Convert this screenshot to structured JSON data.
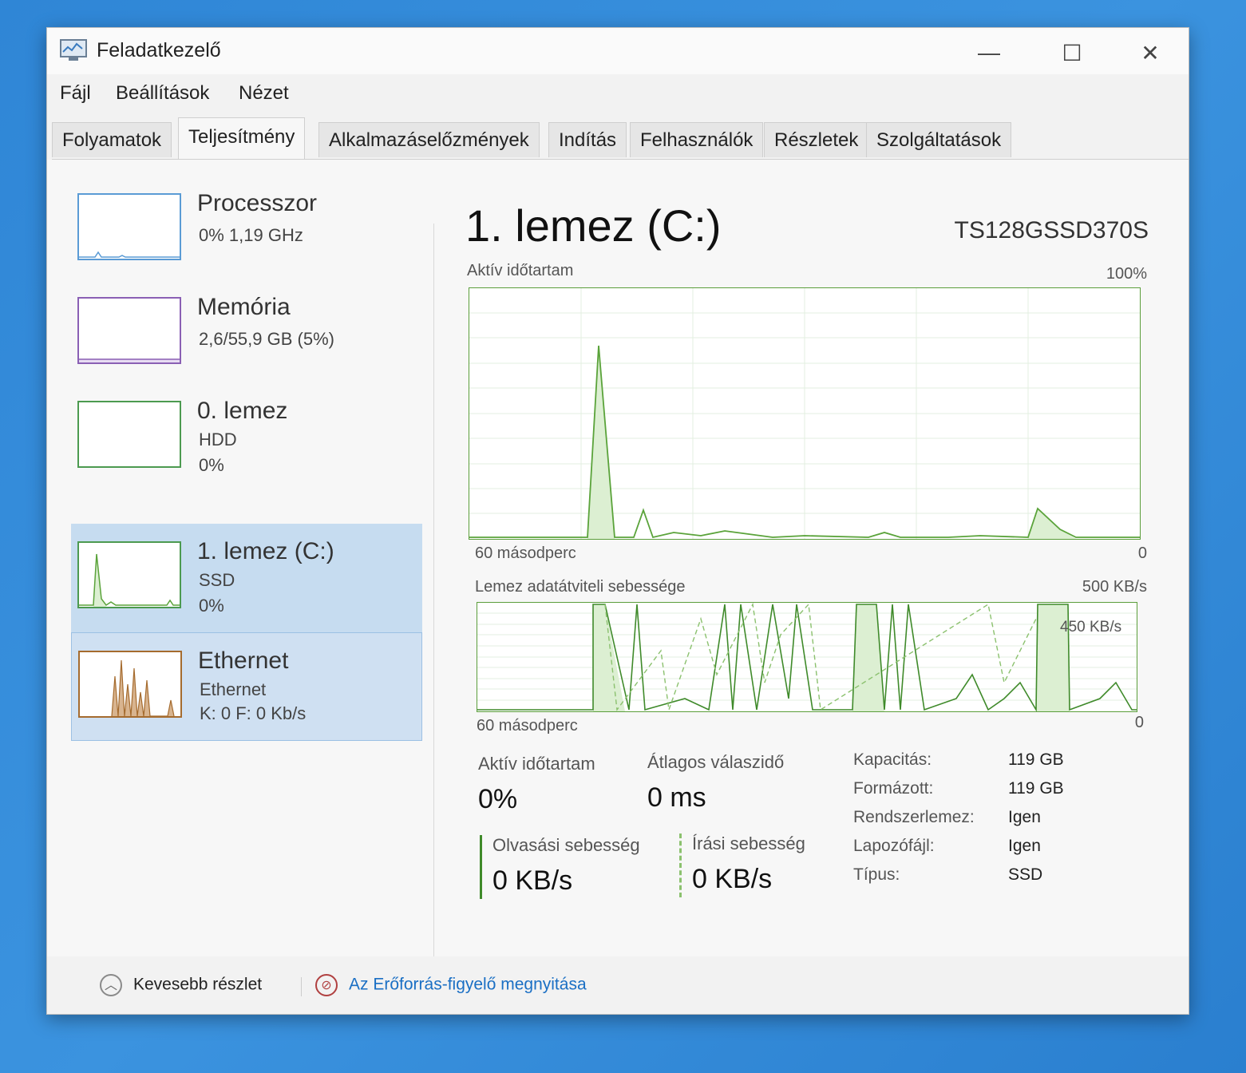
{
  "window": {
    "title": "Feladatkezelő",
    "buttons": {
      "minimize": "—",
      "maximize": "☐",
      "close": "✕"
    }
  },
  "menu": [
    "Fájl",
    "Beállítások",
    "Nézet"
  ],
  "tabs": [
    "Folyamatok",
    "Teljesítmény",
    "Alkalmazáselőzmények",
    "Indítás",
    "Felhasználók",
    "Részletek",
    "Szolgáltatások"
  ],
  "active_tab": "Teljesítmény",
  "sidebar": {
    "items": [
      {
        "name": "Processzor",
        "line1": "0% 1,19 GHz",
        "line2": ""
      },
      {
        "name": "Memória",
        "line1": "2,6/55,9 GB (5%)",
        "line2": ""
      },
      {
        "name": "0. lemez",
        "line1": "HDD",
        "line2": "0%"
      },
      {
        "name": "1. lemez (C:)",
        "line1": "SSD",
        "line2": "0%"
      },
      {
        "name": "Ethernet",
        "line1": "Ethernet",
        "line2": "K: 0 F: 0 Kb/s"
      }
    ]
  },
  "detail": {
    "title": "1. lemez (C:)",
    "model": "TS128GSSD370S",
    "chart1": {
      "label": "Aktív időtartam",
      "max": "100%",
      "left": "60 másodperc",
      "right": "0"
    },
    "chart2": {
      "label": "Lemez adatátviteli sebessége",
      "max": "500 KB/s",
      "marker": "450 KB/s",
      "left": "60 másodperc",
      "right": "0"
    },
    "stats": {
      "active_label": "Aktív időtartam",
      "active_value": "0%",
      "resp_label": "Átlagos válaszidő",
      "resp_value": "0 ms",
      "read_label": "Olvasási sebesség",
      "read_value": "0 KB/s",
      "write_label": "Írási sebesség",
      "write_value": "0 KB/s"
    },
    "properties": [
      {
        "label": "Kapacitás:",
        "value": "119 GB"
      },
      {
        "label": "Formázott:",
        "value": "119 GB"
      },
      {
        "label": "Rendszerlemez:",
        "value": "Igen"
      },
      {
        "label": "Lapozófájl:",
        "value": "Igen"
      },
      {
        "label": "Típus:",
        "value": "SSD"
      }
    ]
  },
  "footer": {
    "fewer_details": "Kevesebb részlet",
    "resource_monitor": "Az Erőforrás-figyelő megnyitása"
  },
  "colors": {
    "disk_line": "#5aa33a",
    "disk_fill": "#dcefd2",
    "selected_bg": "#c6dcf0",
    "link": "#1a6fc4"
  }
}
